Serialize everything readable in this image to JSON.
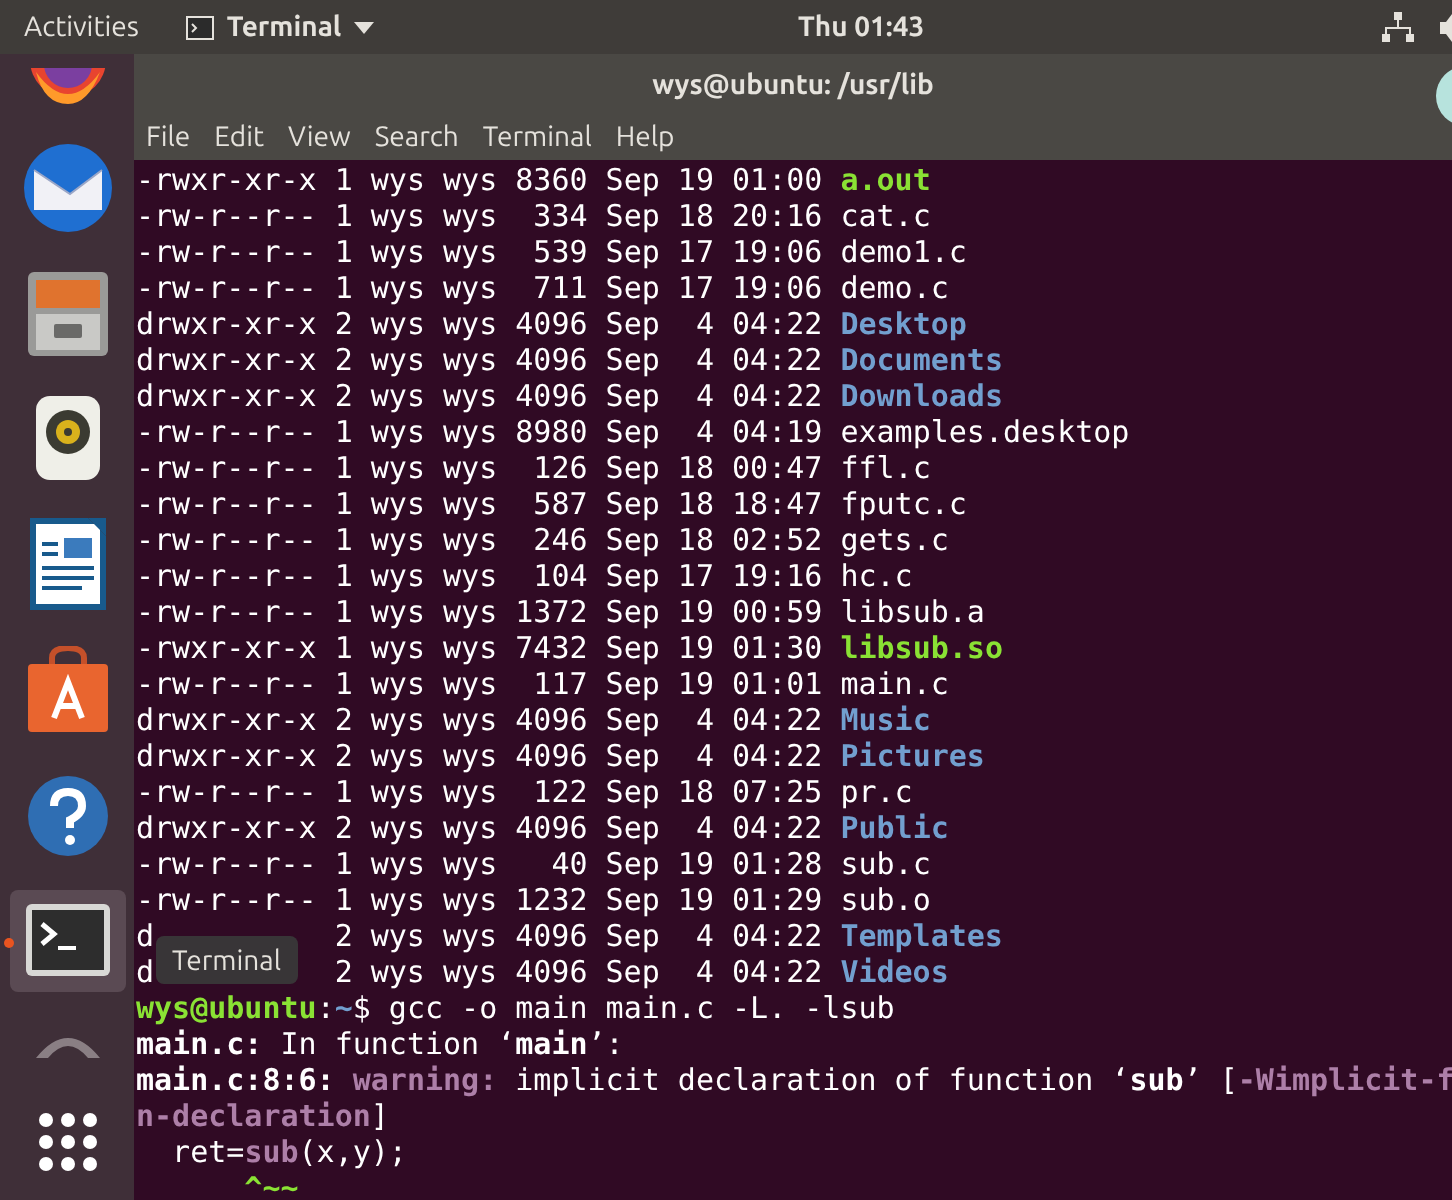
{
  "top_bar": {
    "activities": "Activities",
    "app_menu": "Terminal",
    "clock": "Thu 01:43"
  },
  "window": {
    "title": "wys@ubuntu: /usr/lib",
    "menu": [
      "File",
      "Edit",
      "View",
      "Search",
      "Terminal",
      "Help"
    ]
  },
  "dock": {
    "items": [
      {
        "kind": "firefox",
        "active": false
      },
      {
        "kind": "mail",
        "active": false
      },
      {
        "kind": "files",
        "active": false
      },
      {
        "kind": "music",
        "active": false
      },
      {
        "kind": "writer",
        "active": false
      },
      {
        "kind": "store",
        "active": false
      },
      {
        "kind": "help",
        "active": false
      },
      {
        "kind": "terminal",
        "active": true
      },
      {
        "kind": "refresh",
        "active": false
      },
      {
        "kind": "apps",
        "active": false
      }
    ],
    "tooltip": "Terminal"
  },
  "terminal": {
    "lines": [
      [
        {
          "t": "-rwxr-xr-x 1 wys wys 8360 Sep 19 01:00 "
        },
        {
          "t": "a.out",
          "kind": "exec"
        }
      ],
      [
        {
          "t": "-rw-r--r-- 1 wys wys  334 Sep 18 20:16 cat.c"
        }
      ],
      [
        {
          "t": "-rw-r--r-- 1 wys wys  539 Sep 17 19:06 demo1.c"
        }
      ],
      [
        {
          "t": "-rw-r--r-- 1 wys wys  711 Sep 17 19:06 demo.c"
        }
      ],
      [
        {
          "t": "drwxr-xr-x 2 wys wys 4096 Sep  4 04:22 "
        },
        {
          "t": "Desktop",
          "kind": "dir"
        }
      ],
      [
        {
          "t": "drwxr-xr-x 2 wys wys 4096 Sep  4 04:22 "
        },
        {
          "t": "Documents",
          "kind": "dir"
        }
      ],
      [
        {
          "t": "drwxr-xr-x 2 wys wys 4096 Sep  4 04:22 "
        },
        {
          "t": "Downloads",
          "kind": "dir"
        }
      ],
      [
        {
          "t": "-rw-r--r-- 1 wys wys 8980 Sep  4 04:19 examples.desktop"
        }
      ],
      [
        {
          "t": "-rw-r--r-- 1 wys wys  126 Sep 18 00:47 ffl.c"
        }
      ],
      [
        {
          "t": "-rw-r--r-- 1 wys wys  587 Sep 18 18:47 fputc.c"
        }
      ],
      [
        {
          "t": "-rw-r--r-- 1 wys wys  246 Sep 18 02:52 gets.c"
        }
      ],
      [
        {
          "t": "-rw-r--r-- 1 wys wys  104 Sep 17 19:16 hc.c"
        }
      ],
      [
        {
          "t": "-rw-r--r-- 1 wys wys 1372 Sep 19 00:59 libsub.a"
        }
      ],
      [
        {
          "t": "-rwxr-xr-x 1 wys wys 7432 Sep 19 01:30 "
        },
        {
          "t": "libsub.so",
          "kind": "exec"
        }
      ],
      [
        {
          "t": "-rw-r--r-- 1 wys wys  117 Sep 19 01:01 main.c"
        }
      ],
      [
        {
          "t": "drwxr-xr-x 2 wys wys 4096 Sep  4 04:22 "
        },
        {
          "t": "Music",
          "kind": "dir"
        }
      ],
      [
        {
          "t": "drwxr-xr-x 2 wys wys 4096 Sep  4 04:22 "
        },
        {
          "t": "Pictures",
          "kind": "dir"
        }
      ],
      [
        {
          "t": "-rw-r--r-- 1 wys wys  122 Sep 18 07:25 pr.c"
        }
      ],
      [
        {
          "t": "drwxr-xr-x 2 wys wys 4096 Sep  4 04:22 "
        },
        {
          "t": "Public",
          "kind": "dir"
        }
      ],
      [
        {
          "t": "-rw-r--r-- 1 wys wys   40 Sep 19 01:28 sub.c"
        }
      ],
      [
        {
          "t": "-rw-r--r-- 1 wys wys 1232 Sep 19 01:29 sub.o"
        }
      ],
      [
        {
          "t": "d"
        },
        {
          "t": "2 wys wys 4096 Sep  4 04:22 ",
          "kind": "after_tooltip"
        },
        {
          "t": "Templates",
          "kind": "dir"
        }
      ],
      [
        {
          "t": "d"
        },
        {
          "t": "2 wys wys 4096 Sep  4 04:22 ",
          "kind": "after_tooltip"
        },
        {
          "t": "Videos",
          "kind": "dir"
        }
      ],
      [
        {
          "t": "wys@ubuntu",
          "kind": "user"
        },
        {
          "t": ":"
        },
        {
          "t": "~",
          "kind": "path"
        },
        {
          "t": "$ gcc -o main main.c -L. -lsub"
        }
      ],
      [
        {
          "t": "main.c:",
          "kind": "bold"
        },
        {
          "t": " In function ‘"
        },
        {
          "t": "main",
          "kind": "bold"
        },
        {
          "t": "’:"
        }
      ],
      [
        {
          "t": "main.c:8:6:",
          "kind": "bold"
        },
        {
          "t": " warning:",
          "kind": "warn"
        },
        {
          "t": " implicit declaration of function ‘"
        },
        {
          "t": "sub",
          "kind": "bold"
        },
        {
          "t": "’ ["
        },
        {
          "t": "-Wimplicit-f",
          "kind": "warn"
        }
      ],
      [
        {
          "t": "n-declaration",
          "kind": "warn"
        },
        {
          "t": "]"
        }
      ],
      [
        {
          "t": "  ret="
        },
        {
          "t": "sub",
          "kind": "warn"
        },
        {
          "t": "(x,y);"
        }
      ],
      [
        {
          "t": "      ^~~",
          "kind": "exec"
        }
      ]
    ]
  }
}
